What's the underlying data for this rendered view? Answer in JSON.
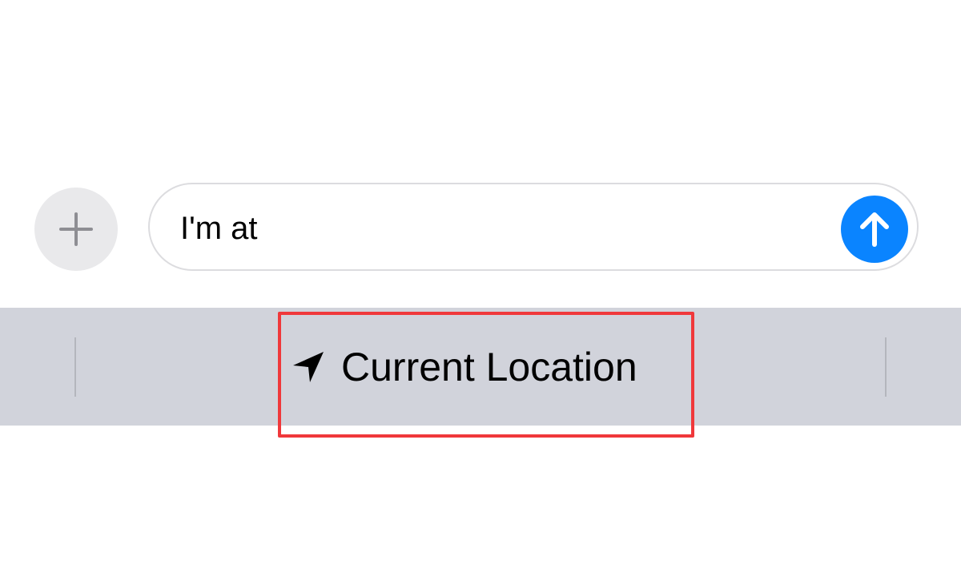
{
  "compose": {
    "plus_icon": "plus-icon",
    "input_value": "I'm at",
    "send_icon": "arrow-up-icon",
    "colors": {
      "plus_bg": "#e9e9eb",
      "send_bg": "#0a84ff"
    }
  },
  "suggestions": {
    "items": [
      {
        "icon": "location-arrow-icon",
        "label": "Current Location"
      }
    ],
    "bar_color": "#d1d3db"
  },
  "annotation": {
    "highlight_color": "#f0383b"
  }
}
